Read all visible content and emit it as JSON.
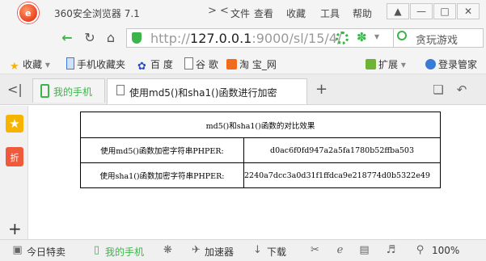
{
  "titlebar": {
    "app_title": "360安全浏览器 7.1",
    "nav_arrows": "> <",
    "menu": [
      "文件",
      "查看",
      "收藏",
      "工具",
      "帮助"
    ],
    "window_buttons": [
      "minimize",
      "maximize",
      "close"
    ]
  },
  "address": {
    "url_prefix": "http://",
    "url_host": "127.0.0.1",
    "url_rest": ":9000/sl/15/4/",
    "search_text": "贪玩游戏",
    "icons": [
      "back-icon",
      "reload-icon",
      "home-icon",
      "shield-icon"
    ]
  },
  "bookmarks": {
    "favorites": "收藏",
    "mobile_favorites": "手机收藏夹",
    "baidu": "百 度",
    "google": "谷 歌",
    "taobao": "淘 宝_网",
    "extensions": "扩展",
    "login": "登录管家"
  },
  "tabs": {
    "phone": "我的手机",
    "active": "使用md5()和sha1()函数进行加密",
    "new_tab": "+"
  },
  "sidebar": {
    "star": "★",
    "zhe": "折",
    "add": "+"
  },
  "table": {
    "title": "md5()和sha1()函数的对比效果",
    "rows": [
      {
        "label": "使用md5()函数加密字符串PHPER:",
        "value": "d0ac6f0fd947a2a5fa1780b52ffba503"
      },
      {
        "label": "使用sha1()函数加密字符串PHPER:",
        "value": "2240a7dcc3a0d31f1ffdca9e218774d0b5322e49"
      }
    ]
  },
  "statusbar": {
    "today": "今日特卖",
    "phone": "我的手机",
    "accelerator": "加速器",
    "download": "下载",
    "zoom": "100%"
  },
  "colors": {
    "accent": "#3bb54a",
    "chrome_bg": "#f4f4f4",
    "star": "#f6b300",
    "zhe": "#f05a3c"
  }
}
